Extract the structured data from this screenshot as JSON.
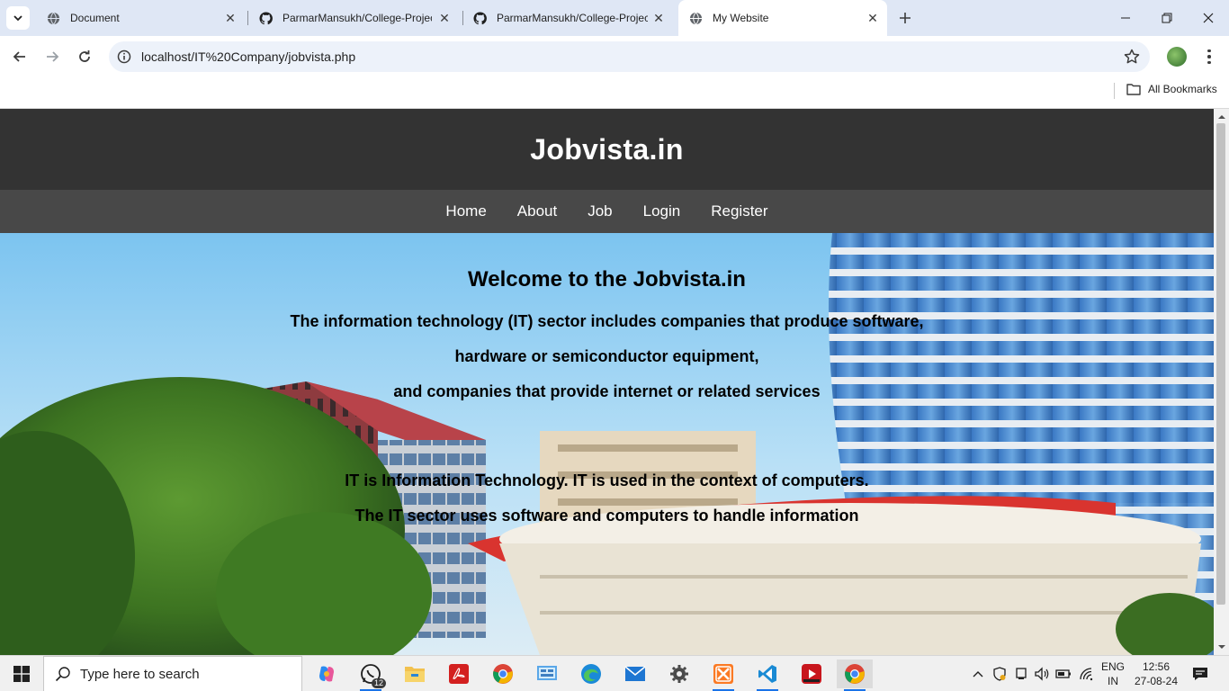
{
  "browser": {
    "tabs": [
      {
        "title": "Document",
        "favicon": "globe-icon",
        "active": false
      },
      {
        "title": "ParmarMansukh/College-Projec",
        "favicon": "github-icon",
        "active": false
      },
      {
        "title": "ParmarMansukh/College-Projec",
        "favicon": "github-icon",
        "active": false
      },
      {
        "title": "My Website",
        "favicon": "globe-icon",
        "active": true
      }
    ],
    "url": "localhost/IT%20Company/jobvista.php",
    "bookmarks_label": "All Bookmarks",
    "accent": "#dfe7f5"
  },
  "site": {
    "title": "Jobvista.in",
    "nav": [
      "Home",
      "About",
      "Job",
      "Login",
      "Register"
    ],
    "hero": {
      "heading": "Welcome to the Jobvista.in",
      "lines": [
        "The information technology (IT) sector includes companies that produce software,",
        "hardware or semiconductor equipment,",
        "and companies that provide internet or related services",
        "IT is Information Technology. IT is used in the context of computers.",
        "The IT sector uses software and computers to handle information"
      ]
    },
    "colors": {
      "header": "#333333",
      "nav": "#484848"
    }
  },
  "taskbar": {
    "search_placeholder": "Type here to search",
    "apps": [
      "copilot-icon",
      "whatsapp-icon",
      "file-explorer-icon",
      "acrobat-icon",
      "chrome-icon",
      "control-panel-icon",
      "edge-icon",
      "mail-icon",
      "settings-icon",
      "xampp-icon",
      "vscode-icon",
      "media-player-icon",
      "chrome-icon"
    ],
    "whatsapp_badge": "12",
    "lang_top": "ENG",
    "lang_bottom": "IN",
    "time": "12:56",
    "date": "27-08-24"
  }
}
